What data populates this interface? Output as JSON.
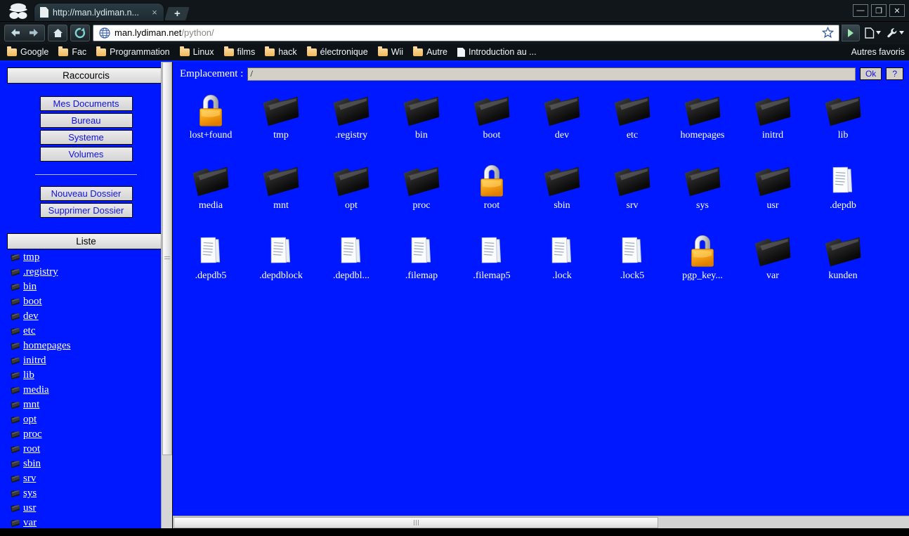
{
  "browser": {
    "incognito_icon": "incognito-hat-icon",
    "tab": {
      "title": "http://man.lydiman.n...",
      "close_label": "×",
      "page_icon": "page-icon"
    },
    "new_tab_label": "+",
    "window_controls": {
      "minimize": "—",
      "maximize": "❐",
      "close": "✕"
    },
    "nav": {
      "back_icon": "back-arrow-icon",
      "forward_icon": "forward-arrow-icon",
      "home_icon": "home-icon",
      "reload_icon": "reload-icon"
    },
    "omnibox": {
      "favicon": "globe-icon",
      "url_host": "man.lydiman.net",
      "url_path": "/python/",
      "star_icon": "bookmark-star-icon",
      "go_icon": "go-arrow-icon"
    },
    "toolbar_right": {
      "page_menu_icon": "page-menu-icon",
      "wrench_menu_icon": "wrench-menu-icon"
    },
    "bookmarks": [
      {
        "label": "Google",
        "type": "folder"
      },
      {
        "label": "Fac",
        "type": "folder"
      },
      {
        "label": "Programmation",
        "type": "folder"
      },
      {
        "label": "Linux",
        "type": "folder"
      },
      {
        "label": "films",
        "type": "folder"
      },
      {
        "label": "hack",
        "type": "folder"
      },
      {
        "label": "électronique",
        "type": "folder"
      },
      {
        "label": "Wii",
        "type": "folder"
      },
      {
        "label": "Autre",
        "type": "folder"
      },
      {
        "label": "Introduction au ...",
        "type": "page"
      }
    ],
    "bookmarks_overflow": {
      "label": "Autres favoris",
      "type": "folder"
    }
  },
  "page": {
    "background_color": "#0018ff",
    "sidebar": {
      "shortcuts_header": "Raccourcis",
      "shortcut_buttons": [
        "Mes Documents",
        "Bureau",
        "Systeme",
        "Volumes"
      ],
      "action_buttons": [
        "Nouveau Dossier",
        "Supprimer Dossier"
      ],
      "list_header": "Liste",
      "list_items": [
        "tmp",
        ".registry",
        "bin",
        "boot",
        "dev",
        "etc",
        "homepages",
        "initrd",
        "lib",
        "media",
        "mnt",
        "opt",
        "proc",
        "root",
        "sbin",
        "srv",
        "sys",
        "usr",
        "var"
      ]
    },
    "location": {
      "label": "Emplacement :",
      "value": "/",
      "placeholder": "/",
      "ok_label": "Ok",
      "help_label": "?"
    },
    "files": [
      {
        "name": "lost+found",
        "type": "lock"
      },
      {
        "name": "tmp",
        "type": "folder"
      },
      {
        "name": ".registry",
        "type": "folder"
      },
      {
        "name": "bin",
        "type": "folder"
      },
      {
        "name": "boot",
        "type": "folder"
      },
      {
        "name": "dev",
        "type": "folder"
      },
      {
        "name": "etc",
        "type": "folder"
      },
      {
        "name": "homepages",
        "type": "folder"
      },
      {
        "name": "initrd",
        "type": "folder"
      },
      {
        "name": "lib",
        "type": "folder"
      },
      {
        "name": "media",
        "type": "folder"
      },
      {
        "name": "mnt",
        "type": "folder"
      },
      {
        "name": "opt",
        "type": "folder"
      },
      {
        "name": "proc",
        "type": "folder"
      },
      {
        "name": "root",
        "type": "lock"
      },
      {
        "name": "sbin",
        "type": "folder"
      },
      {
        "name": "srv",
        "type": "folder"
      },
      {
        "name": "sys",
        "type": "folder"
      },
      {
        "name": "usr",
        "type": "folder"
      },
      {
        "name": ".depdb",
        "type": "document"
      },
      {
        "name": ".depdb5",
        "type": "document"
      },
      {
        "name": ".depdblock",
        "type": "document"
      },
      {
        "name": ".depdbl...",
        "type": "document"
      },
      {
        "name": ".filemap",
        "type": "document"
      },
      {
        "name": ".filemap5",
        "type": "document"
      },
      {
        "name": ".lock",
        "type": "document"
      },
      {
        "name": ".lock5",
        "type": "document"
      },
      {
        "name": "pgp_key...",
        "type": "lock"
      },
      {
        "name": "var",
        "type": "folder"
      },
      {
        "name": "kunden",
        "type": "folder"
      }
    ]
  }
}
